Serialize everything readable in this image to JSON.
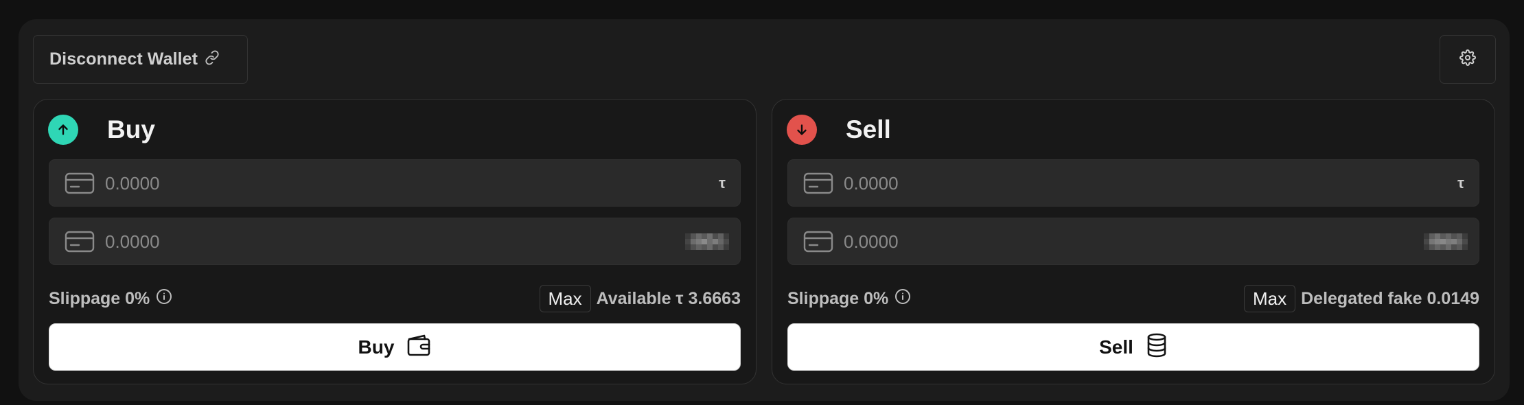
{
  "header": {
    "disconnect_label": "Disconnect Wallet",
    "link_icon": "link-icon",
    "settings_icon": "gear-icon"
  },
  "buy": {
    "title": "Buy",
    "icon": "arrow-up-circle-icon",
    "icon_color": "#2fd6b5",
    "input1": {
      "placeholder": "0.0000",
      "suffix": "τ",
      "icon": "credit-card-icon"
    },
    "input2": {
      "placeholder": "0.0000",
      "icon": "credit-card-icon"
    },
    "slippage_label": "Slippage 0%",
    "max_label": "Max",
    "available_label": "Available τ 3.6663",
    "action_label": "Buy",
    "action_icon": "wallet-icon"
  },
  "sell": {
    "title": "Sell",
    "icon": "arrow-down-circle-icon",
    "icon_color": "#e2524c",
    "input1": {
      "placeholder": "0.0000",
      "suffix": "τ",
      "icon": "credit-card-icon"
    },
    "input2": {
      "placeholder": "0.0000",
      "icon": "credit-card-icon"
    },
    "slippage_label": "Slippage 0%",
    "max_label": "Max",
    "available_label": "Delegated fake 0.0149",
    "action_label": "Sell",
    "action_icon": "database-icon"
  },
  "colors": {
    "background": "#111111",
    "card": "#1c1c1c",
    "panel": "#181818",
    "input": "#2a2a2a",
    "buy_accent": "#2fd6b5",
    "sell_accent": "#e2524c",
    "button": "#ffffff"
  }
}
